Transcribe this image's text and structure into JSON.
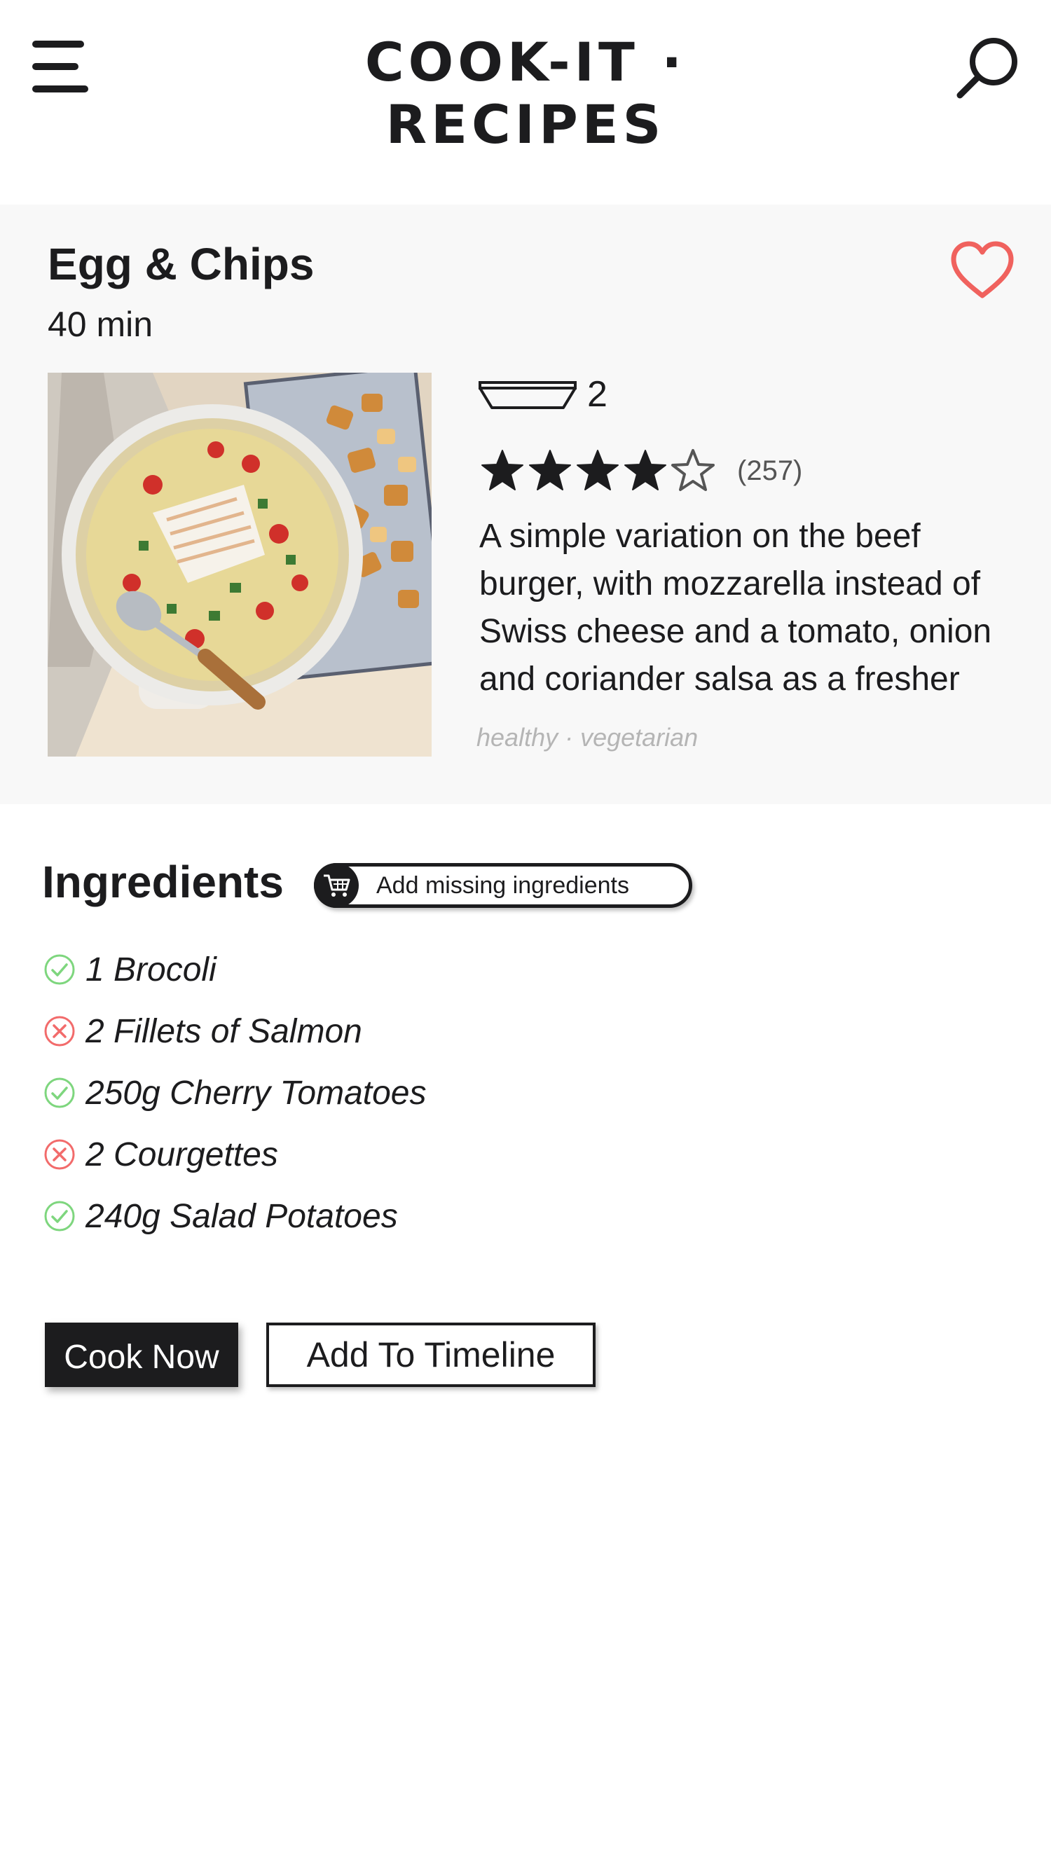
{
  "header": {
    "title": "COOK-IT · RECIPES"
  },
  "recipe": {
    "title": "Egg & Chips",
    "time": "40 min",
    "servings": "2",
    "rating_value": 4,
    "rating_max": 5,
    "rating_count": "(257)",
    "description": "A simple variation on the beef burger, with mozzarella instead of Swiss cheese and a tomato, onion and coriander salsa as a fresher",
    "tags": "healthy · vegetarian",
    "favorite_color": "#f0625e"
  },
  "ingredients": {
    "title": "Ingredients",
    "add_missing_label": "Add missing ingredients",
    "items": [
      {
        "text": "1 Brocoli",
        "available": true
      },
      {
        "text": "2 Fillets of Salmon",
        "available": false
      },
      {
        "text": "250g Cherry Tomatoes",
        "available": true
      },
      {
        "text": "2 Courgettes",
        "available": false
      },
      {
        "text": "240g Salad Potatoes",
        "available": true
      }
    ],
    "available_color": "#7ed67e",
    "missing_color": "#f26b6b"
  },
  "actions": {
    "cook_now_label": "Cook Now",
    "timeline_label": "Add To Timeline"
  }
}
